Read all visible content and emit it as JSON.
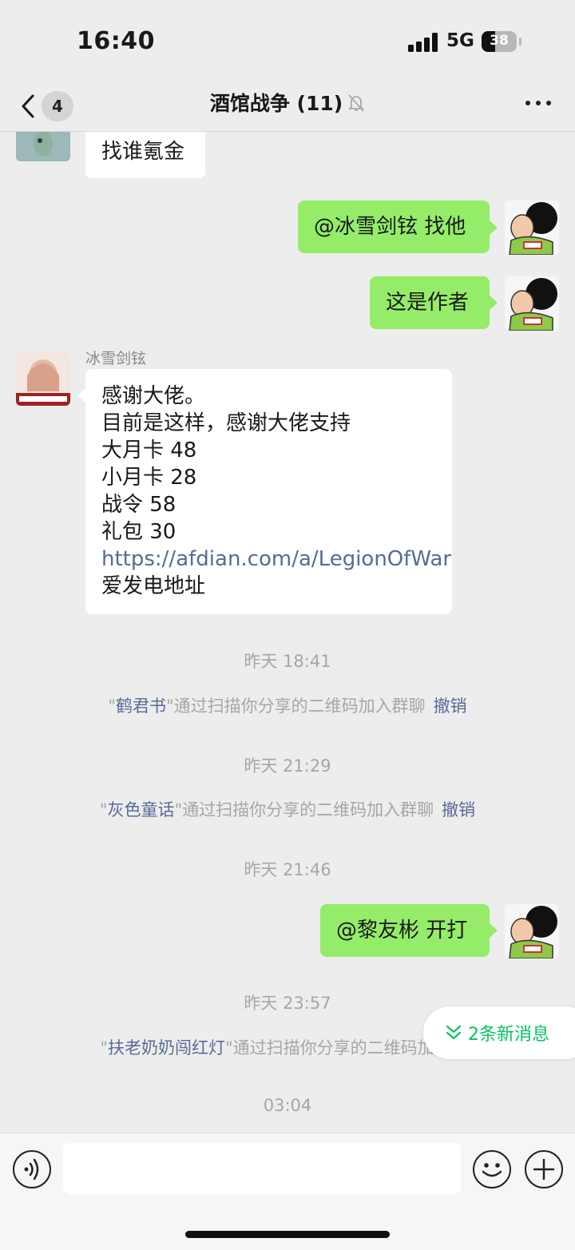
{
  "status_bar": {
    "time": "16:40",
    "network": "5G",
    "battery": "38",
    "battery_level": 0.38
  },
  "header": {
    "back_badge": "4",
    "title": "酒馆战争 (11)",
    "muted_icon": "bell-slash-icon",
    "more_icon": "more-dots-icon"
  },
  "messages": [
    {
      "side": "left",
      "text": "找谁氪金"
    },
    {
      "side": "right",
      "text": "@冰雪剑铉 找他"
    },
    {
      "side": "right",
      "text": "这是作者"
    },
    {
      "side": "left",
      "sender": "冰雪剑铉",
      "lines": [
        "感谢大佬。",
        "目前是这样，感谢大佬支持",
        "大月卡 48",
        "小月卡 28",
        "战令 58",
        "礼包 30",
        "https://afdian.com/a/LegionOfWar",
        "爱发电地址"
      ]
    },
    {
      "side": "right",
      "text": "@黎友彬 开打"
    }
  ],
  "timestamps": [
    "昨天 18:41",
    "昨天 21:29",
    "昨天 21:46",
    "昨天 23:57",
    "03:04"
  ],
  "system_messages": [
    {
      "name": "鹤君书",
      "text": "通过扫描你分享的二维码加入群聊",
      "action": "撤销"
    },
    {
      "name": "灰色童话",
      "text": "通过扫描你分享的二维码加入群聊",
      "action": "撤销"
    },
    {
      "name": "扶老奶奶闯红灯",
      "text": "通过扫描你分享的二维码加入"
    }
  ],
  "new_messages_button": "2条新消息",
  "input_bar": {
    "voice_icon": "voice-icon",
    "emoji_icon": "emoji-icon",
    "plus_icon": "plus-icon",
    "value": ""
  },
  "colors": {
    "background": "#ededed",
    "sent_bubble": "#95ec69",
    "received_bubble": "#ffffff",
    "link": "#576b95",
    "accent": "#07c160"
  }
}
